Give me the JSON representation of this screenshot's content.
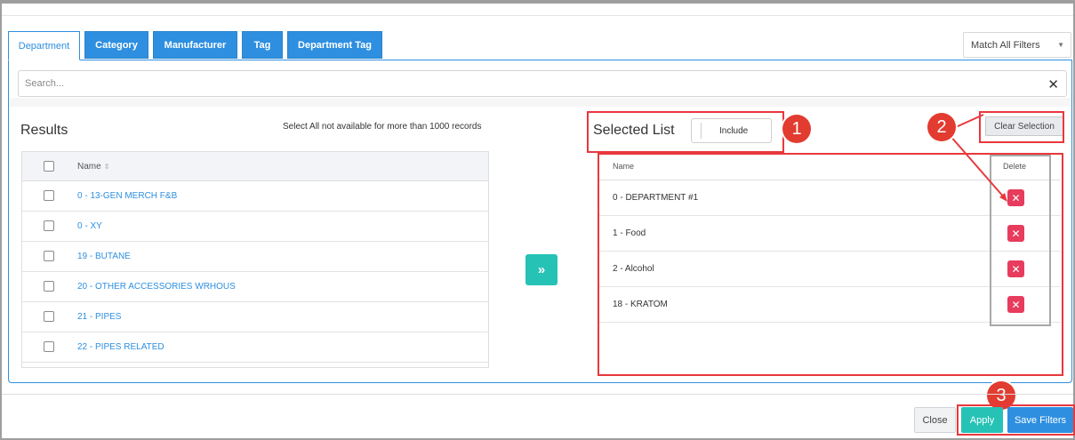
{
  "tabs": [
    {
      "label": "Department",
      "active": true
    },
    {
      "label": "Category",
      "active": false
    },
    {
      "label": "Manufacturer",
      "active": false
    },
    {
      "label": "Tag",
      "active": false
    },
    {
      "label": "Department Tag",
      "active": false
    }
  ],
  "filter_mode": {
    "selected": "Match All Filters"
  },
  "search": {
    "placeholder": "Search...",
    "value": "",
    "clear_icon": "close-icon"
  },
  "results": {
    "title": "Results",
    "note": "Select All not available for more than 1000 records",
    "column_name": "Name",
    "rows": [
      "0 - 13-GEN MERCH F&B",
      "0 - XY",
      "19 - BUTANE",
      "20 - OTHER ACCESSORIES WRHOUS",
      "21 - PIPES",
      "22 - PIPES RELATED"
    ]
  },
  "move_button": {
    "icon": "double-chevron-right-icon"
  },
  "selected": {
    "title": "Selected List",
    "toggle_label": "Include",
    "clear_label": "Clear Selection",
    "column_name": "Name",
    "column_delete": "Delete",
    "rows": [
      "0 - DEPARTMENT #1",
      "1 - Food",
      "2 - Alcohol",
      "18 - KRATOM"
    ]
  },
  "footer": {
    "close_label": "Close",
    "apply_label": "Apply",
    "save_label": "Save Filters"
  },
  "annotations": {
    "badges": [
      "1",
      "2",
      "3"
    ],
    "color": "#e23b30"
  },
  "colors": {
    "primary": "#2e8fe0",
    "teal": "#26c2b6",
    "danger": "#e73c5d"
  }
}
